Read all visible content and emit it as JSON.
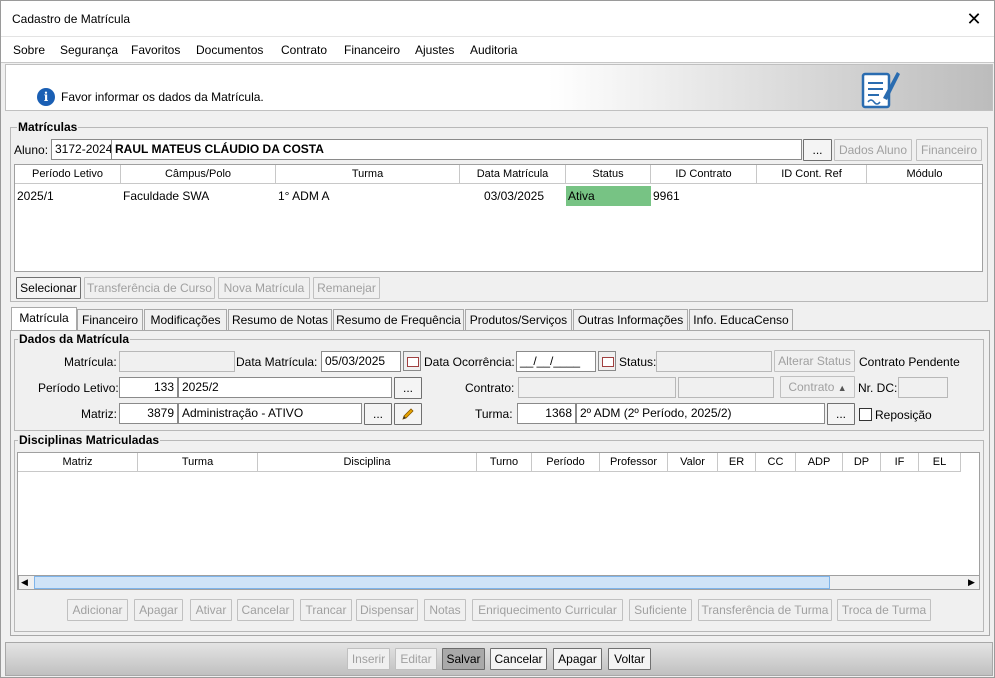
{
  "window": {
    "title": "Cadastro de Matrícula"
  },
  "menu": [
    "Sobre",
    "Segurança",
    "Favoritos",
    "Documentos",
    "Contrato",
    "Financeiro",
    "Ajustes",
    "Auditoria"
  ],
  "header": {
    "message": "Favor informar os dados da Matrícula."
  },
  "matriculas": {
    "group_label": "Matrículas",
    "aluno_label": "Aluno:",
    "aluno_code": "3172-2024",
    "aluno_name": "RAUL MATEUS CLÁUDIO DA COSTA",
    "browse_btn": "...",
    "dados_aluno_btn": "Dados Aluno",
    "financeiro_btn": "Financeiro",
    "columns": [
      "Período Letivo",
      "Câmpus/Polo",
      "Turma",
      "Data Matrícula",
      "Status",
      "ID Contrato",
      "ID Cont. Ref",
      "Módulo"
    ],
    "rows": [
      {
        "periodo": "2025/1",
        "campus": "Faculdade SWA",
        "turma": "1° ADM A",
        "data": "03/03/2025",
        "status": "Ativa",
        "id_contrato": "9961",
        "id_ref": "",
        "modulo": ""
      }
    ],
    "status_color": "#77c384",
    "buttons": {
      "selecionar": "Selecionar",
      "transferencia": "Transferência de Curso",
      "nova": "Nova Matrícula",
      "remanejar": "Remanejar"
    }
  },
  "tabs": [
    "Matrícula",
    "Financeiro",
    "Modificações",
    "Resumo de Notas",
    "Resumo de Frequência",
    "Produtos/Serviços",
    "Outras Informações",
    "Info. EducaCenso"
  ],
  "dados": {
    "group_label": "Dados da Matrícula",
    "matricula_label": "Matrícula:",
    "matricula_value": "",
    "data_matricula_label": "Data Matrícula:",
    "data_matricula_value": "05/03/2025",
    "data_ocorrencia_label": "Data Ocorrência:",
    "data_ocorrencia_value": "__/__/____",
    "status_label": "Status:",
    "status_value": "",
    "alterar_status_btn": "Alterar Status",
    "contrato_pendente": "Contrato Pendente",
    "periodo_label": "Período Letivo:",
    "periodo_code": "133",
    "periodo_value": "2025/2",
    "contrato_label": "Contrato:",
    "contrato_btn": "Contrato",
    "nr_dc_label": "Nr. DC:",
    "matriz_label": "Matriz:",
    "matriz_code": "3879",
    "matriz_value": "Administração - ATIVO",
    "turma_label": "Turma:",
    "turma_code": "1368",
    "turma_value": "2º ADM (2º Período, 2025/2)",
    "reposicao_label": "Reposição"
  },
  "disciplinas": {
    "group_label": "Disciplinas Matriculadas",
    "columns": [
      "Matriz",
      "Turma",
      "Disciplina",
      "Turno",
      "Período",
      "Professor",
      "Valor",
      "ER",
      "CC",
      "ADP",
      "DP",
      "IF",
      "EL"
    ],
    "buttons": [
      "Adicionar",
      "Apagar",
      "Ativar",
      "Cancelar",
      "Trancar",
      "Dispensar",
      "Notas",
      "Enriquecimento Curricular",
      "Suficiente",
      "Transferência de Turma",
      "Troca de Turma"
    ]
  },
  "footer": {
    "inserir": "Inserir",
    "editar": "Editar",
    "salvar": "Salvar",
    "cancelar": "Cancelar",
    "apagar": "Apagar",
    "voltar": "Voltar"
  },
  "colors": {
    "info_icon": "#1a5fb4",
    "scroll_thumb": "#cfe3f7"
  }
}
